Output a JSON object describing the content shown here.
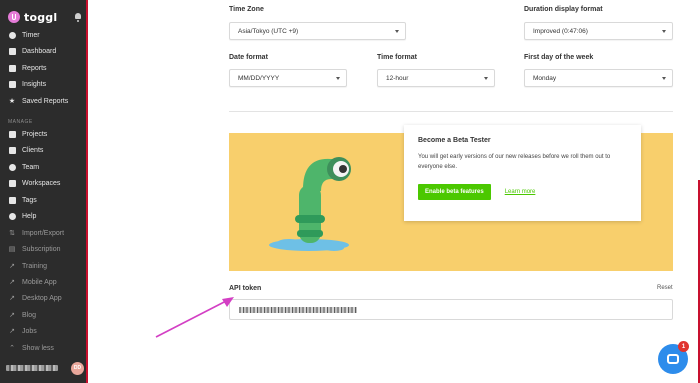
{
  "app": {
    "logo_text": "toggl"
  },
  "sidebar": {
    "items": [
      {
        "label": "Timer",
        "icon": "clock-icon"
      },
      {
        "label": "Dashboard",
        "icon": "dashboard-icon"
      },
      {
        "label": "Reports",
        "icon": "reports-icon"
      },
      {
        "label": "Insights",
        "icon": "insights-icon"
      },
      {
        "label": "Saved Reports",
        "icon": "star-icon"
      }
    ],
    "manage_label": "MANAGE",
    "manage_items": [
      {
        "label": "Projects",
        "icon": "projects-icon"
      },
      {
        "label": "Clients",
        "icon": "clients-icon"
      },
      {
        "label": "Team",
        "icon": "team-icon"
      },
      {
        "label": "Workspaces",
        "icon": "workspaces-icon"
      },
      {
        "label": "Tags",
        "icon": "tag-icon"
      },
      {
        "label": "Help",
        "icon": "help-icon"
      },
      {
        "label": "Import/Export",
        "icon": "import-export-icon"
      },
      {
        "label": "Subscription",
        "icon": "subscription-icon"
      },
      {
        "label": "Training",
        "icon": "external-link-icon"
      },
      {
        "label": "Mobile App",
        "icon": "external-link-icon"
      },
      {
        "label": "Desktop App",
        "icon": "external-link-icon"
      },
      {
        "label": "Blog",
        "icon": "external-link-icon"
      },
      {
        "label": "Jobs",
        "icon": "external-link-icon"
      },
      {
        "label": "Show less",
        "icon": "chevron-up-icon"
      }
    ],
    "avatar_initials": "DD"
  },
  "settings": {
    "timezone": {
      "label": "Time Zone",
      "value": "Asia/Tokyo (UTC +9)"
    },
    "duration_format": {
      "label": "Duration display format",
      "value": "Improved (0:47:06)"
    },
    "date_format": {
      "label": "Date format",
      "value": "MM/DD/YYYY"
    },
    "time_format": {
      "label": "Time format",
      "value": "12-hour"
    },
    "first_day": {
      "label": "First day of the week",
      "value": "Monday"
    }
  },
  "beta": {
    "title": "Become a Beta Tester",
    "description": "You will get early versions of our new releases before we roll them out to everyone else.",
    "button_label": "Enable beta features",
    "link_label": "Learn more"
  },
  "api": {
    "label": "API token",
    "reset_label": "Reset"
  },
  "chat": {
    "badge_count": "1"
  },
  "colors": {
    "sidebar_bg": "#2c2c2c",
    "accent_red": "#c8102e",
    "beta_banner_bg": "#f8cf6c",
    "beta_button": "#4bc800",
    "chat_button": "#2d8ceb",
    "annotation_arrow": "#d33fc4"
  }
}
